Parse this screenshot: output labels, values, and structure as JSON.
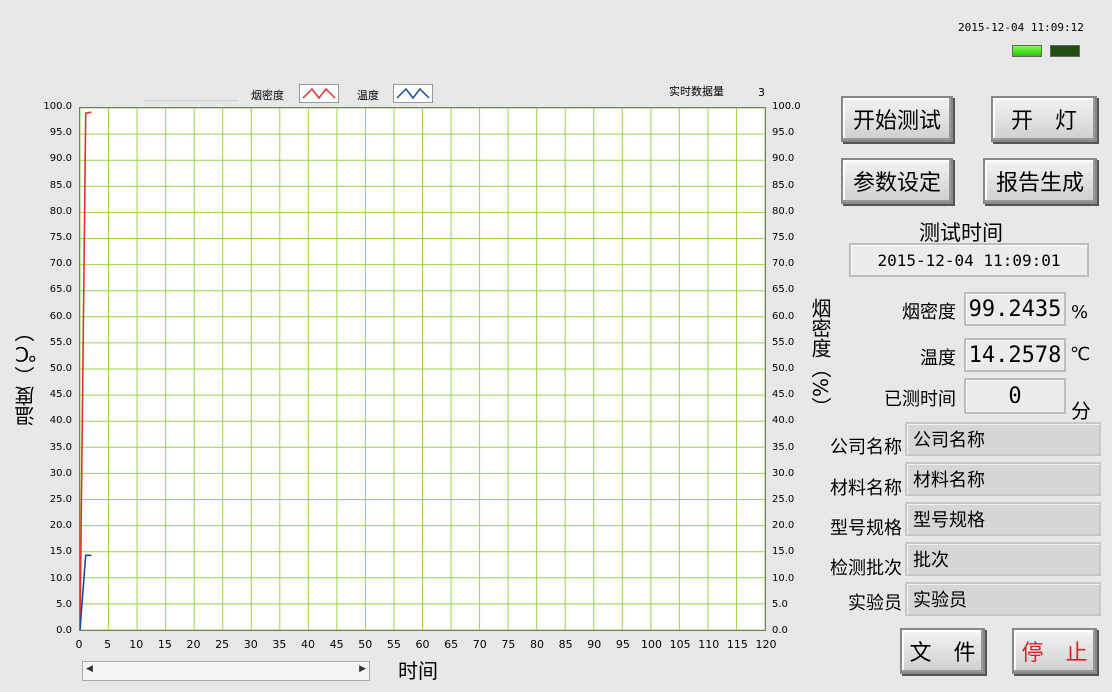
{
  "header": {
    "datetime": "2015-12-04 11:09:12"
  },
  "legend": {
    "smoke_label": "烟密度",
    "temp_label": "温度",
    "realtime_label": "实时数据量",
    "realtime_value": "3"
  },
  "axes": {
    "left_title": "温度（℃）",
    "right_title": "烟密度（%）",
    "x_title": "时间",
    "y_ticks": [
      "100.0",
      "95.0",
      "90.0",
      "85.0",
      "80.0",
      "75.0",
      "70.0",
      "65.0",
      "60.0",
      "55.0",
      "50.0",
      "45.0",
      "40.0",
      "35.0",
      "30.0",
      "25.0",
      "20.0",
      "15.0",
      "10.0",
      "5.0",
      "0.0"
    ],
    "x_ticks": [
      "0",
      "5",
      "10",
      "15",
      "20",
      "25",
      "30",
      "35",
      "40",
      "45",
      "50",
      "55",
      "60",
      "65",
      "70",
      "75",
      "80",
      "85",
      "90",
      "95",
      "100",
      "105",
      "110",
      "115",
      "120"
    ]
  },
  "chart_data": {
    "type": "line",
    "x_range": [
      0,
      120
    ],
    "y_range": [
      0,
      100
    ],
    "grid": true,
    "series": [
      {
        "name": "烟密度",
        "color": "#e03030",
        "x": [
          0,
          1,
          2
        ],
        "y": [
          0,
          99.0,
          99.2
        ]
      },
      {
        "name": "温度",
        "color": "#1a4aa8",
        "x": [
          0,
          1,
          2
        ],
        "y": [
          0,
          14.3,
          14.3
        ]
      }
    ]
  },
  "buttons": {
    "start_test": "开始测试",
    "light": "开　灯",
    "params": "参数设定",
    "report": "报告生成",
    "file": "文　件",
    "stop": "停　止"
  },
  "test_time": {
    "title": "测试时间",
    "value": "2015-12-04  11:09:01"
  },
  "readings": {
    "smoke_label": "烟密度",
    "smoke_value": "99.2435",
    "smoke_unit": "%",
    "temp_label": "温度",
    "temp_value": "14.2578",
    "temp_unit": "℃",
    "elapsed_label": "已测时间",
    "elapsed_value": "0",
    "elapsed_unit": "分"
  },
  "info": {
    "company_label": "公司名称",
    "company_value": "公司名称",
    "material_label": "材料名称",
    "material_value": "材料名称",
    "model_label": "型号规格",
    "model_value": "型号规格",
    "batch_label": "检测批次",
    "batch_value": "批次",
    "tester_label": "实验员",
    "tester_value": "实验员"
  },
  "colors": {
    "grid": "#9ad44a",
    "smoke": "#e03030",
    "temp": "#1a4aa8",
    "stop_text": "#e02020"
  }
}
